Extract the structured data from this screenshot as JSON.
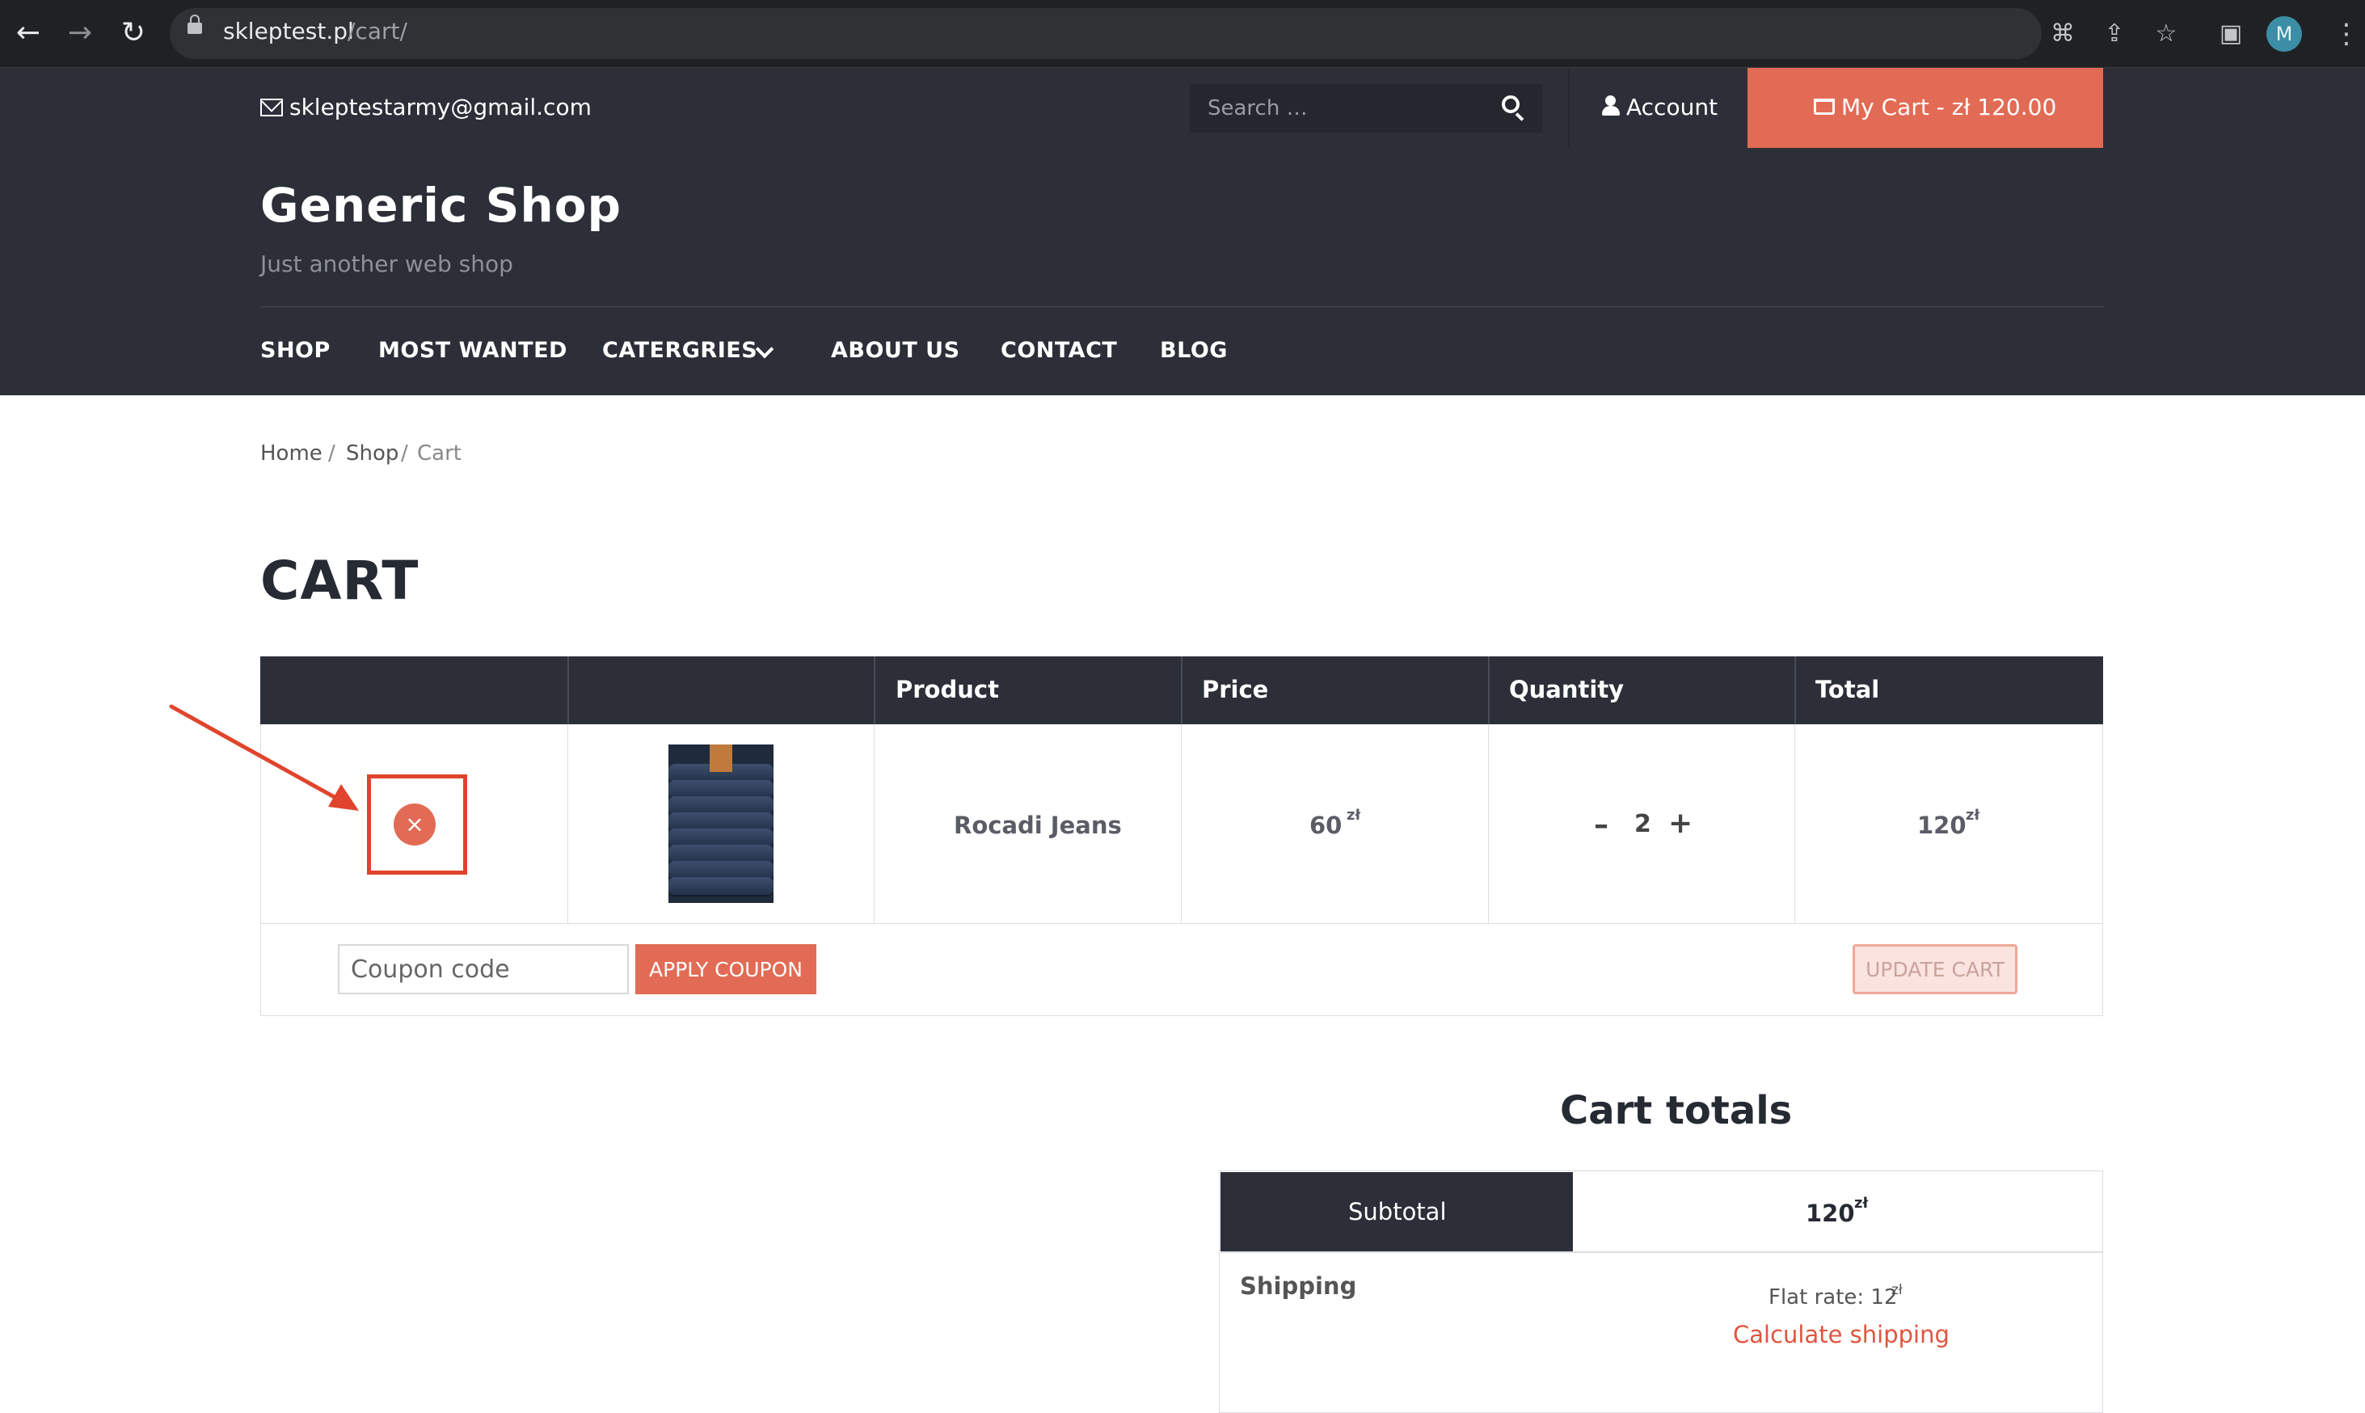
{
  "browser": {
    "url_host": "skleptest.pl",
    "url_path": "/cart/",
    "profile_initial": "M"
  },
  "topbar": {
    "email": "skleptestarmy@gmail.com",
    "search_placeholder": "Search …",
    "account_label": "Account",
    "cart_label": "My Cart - zł 120.00"
  },
  "header": {
    "site_title": "Generic Shop",
    "tagline": "Just another web shop",
    "menu": [
      "SHOP",
      "MOST WANTED",
      "CATERGRIES",
      "ABOUT US",
      "CONTACT",
      "BLOG"
    ]
  },
  "breadcrumb": {
    "home": "Home",
    "sep": "/",
    "shop": "Shop",
    "current": "Cart"
  },
  "page_title": "CART",
  "cart_table": {
    "headers": [
      "",
      "",
      "Product",
      "Price",
      "Quantity",
      "Total"
    ],
    "rows": [
      {
        "remove_symbol": "×",
        "product": "Rocadi Jeans",
        "price": "60",
        "currency": "zł",
        "quantity": "2",
        "total": "120"
      }
    ],
    "qty_minus": "–",
    "qty_plus": "+"
  },
  "coupon": {
    "placeholder": "Coupon code",
    "apply_label": "APPLY COUPON",
    "update_label": "UPDATE CART"
  },
  "totals": {
    "title": "Cart totals",
    "subtotal_label": "Subtotal",
    "subtotal_value": "120",
    "currency": "zł",
    "shipping_label": "Shipping",
    "flat_rate": "Flat rate: 12",
    "calculate_shipping": "Calculate shipping"
  },
  "colors": {
    "accent": "#e26b55",
    "dark": "#2c2f38",
    "annotation": "#e0442c"
  }
}
